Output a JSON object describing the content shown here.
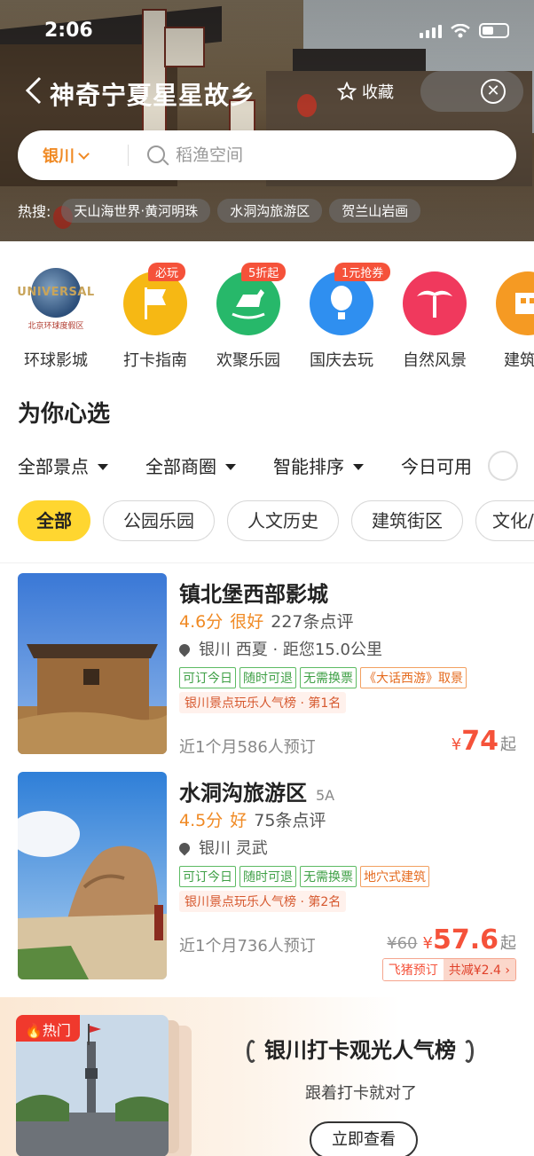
{
  "status_bar": {
    "time": "2:06"
  },
  "header": {
    "title": "神奇宁夏星星故乡",
    "favorite_label": "收藏"
  },
  "search": {
    "city": "银川",
    "placeholder": "稻渔空间"
  },
  "hot_search": {
    "label": "热搜:",
    "tags": [
      "天山海世界·黄河明珠",
      "水洞沟旅游区",
      "贺兰山岩画"
    ]
  },
  "categories": [
    {
      "label": "环球影城",
      "icon": "universal-logo",
      "logo_text": "UNIVERSAL",
      "logo_sub": "北京环球度假区",
      "badge": ""
    },
    {
      "label": "打卡指南",
      "icon": "flag-icon",
      "badge": "必玩",
      "color": "#f6b814"
    },
    {
      "label": "欢聚乐园",
      "icon": "rocking-horse-icon",
      "badge": "5折起",
      "color": "#27b86a"
    },
    {
      "label": "国庆去玩",
      "icon": "balloon-icon",
      "badge": "1元抢券",
      "color": "#2f8ff0"
    },
    {
      "label": "自然风景",
      "icon": "palm-tree-icon",
      "badge": "",
      "color": "#f0395d"
    },
    {
      "label": "建筑街",
      "icon": "building-icon",
      "badge": "",
      "color": "#f59a23"
    }
  ],
  "section": {
    "title": "为你心选",
    "filters": [
      "全部景点",
      "全部商圈",
      "智能排序",
      "今日可用"
    ],
    "chips": [
      "全部",
      "公园乐园",
      "人文历史",
      "建筑街区",
      "文化/"
    ]
  },
  "listings": [
    {
      "name": "镇北堡西部影城",
      "level": "",
      "score": "4.6分",
      "rating_word": "很好",
      "reviews": "227条点评",
      "location": "银川 西夏 · 距您15.0公里",
      "tags": [
        "可订今日",
        "随时可退",
        "无需换票"
      ],
      "feature_tag": "《大话西游》取景",
      "rank": "银川景点玩乐人气榜 · 第1名",
      "booked": "近1个月586人预订",
      "original_price": "",
      "price_symbol": "¥",
      "price": "74",
      "price_suffix": "起",
      "promo_a": "",
      "promo_b": ""
    },
    {
      "name": "水洞沟旅游区",
      "level": "5A",
      "score": "4.5分",
      "rating_word": "好",
      "reviews": "75条点评",
      "location": "银川 灵武",
      "tags": [
        "可订今日",
        "随时可退",
        "无需换票"
      ],
      "feature_tag": "地穴式建筑",
      "rank": "银川景点玩乐人气榜 · 第2名",
      "booked": "近1个月736人预订",
      "original_price": "¥60",
      "price_symbol": "¥",
      "price": "57.6",
      "price_suffix": "起",
      "promo_a": "飞猪预订",
      "promo_b": "共减¥2.4 ›"
    }
  ],
  "banner": {
    "hot_badge": "热门",
    "title": "银川打卡观光人气榜",
    "subtitle": "跟着打卡就对了",
    "button": "立即查看"
  },
  "colors": {
    "accent_orange": "#f08a24",
    "price_red": "#f5523a",
    "chip_active": "#ffd630",
    "tag_green": "#3fa046"
  }
}
